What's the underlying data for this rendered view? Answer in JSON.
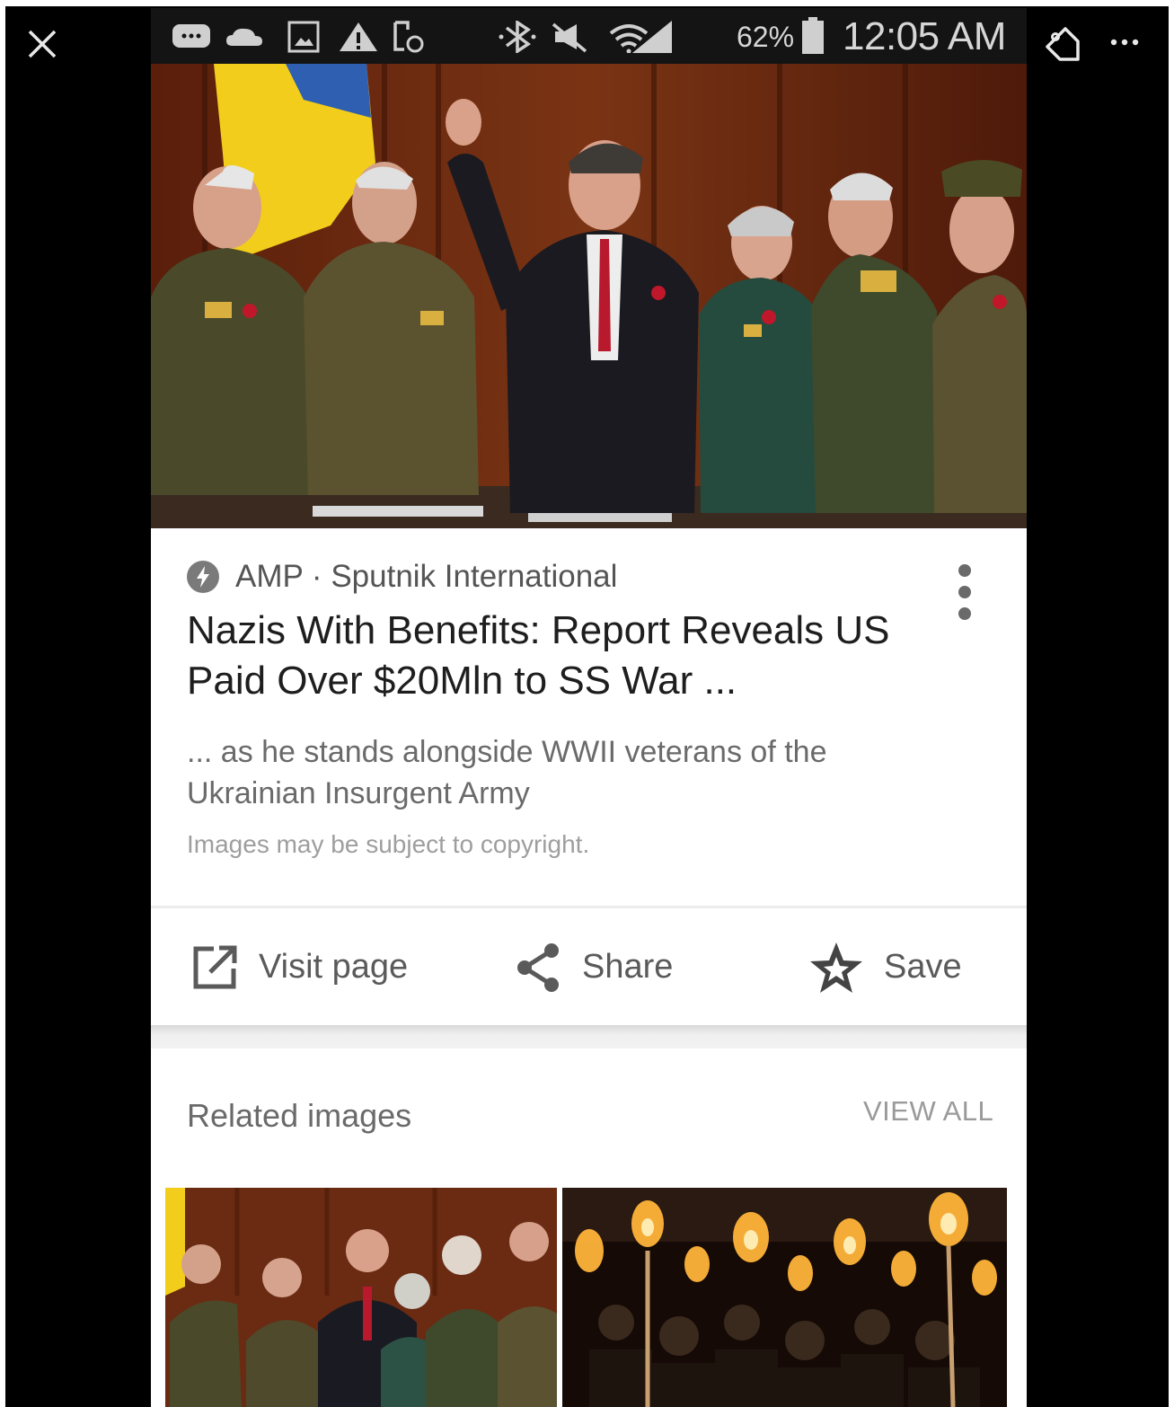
{
  "viewer": {
    "close_icon": "close-icon",
    "tag_icon": "tag-icon",
    "more_icon": "more-horizontal-icon"
  },
  "status_bar": {
    "icons": [
      "message-icon",
      "cloud-icon",
      "image-icon",
      "warning-icon",
      "screenshot-icon",
      "bluetooth-icon",
      "mute-icon",
      "wifi-icon",
      "signal-icon"
    ],
    "battery": "62%",
    "time": "12:05 AM"
  },
  "card": {
    "source": "AMP · Sputnik International",
    "title": "Nazis With Benefits: Report Reveals US Paid Over $20Mln to SS War ...",
    "snippet": "... as he stands alongside WWII veterans of the Ukrainian Insurgent Army",
    "copyright": "Images may be subject to copyright.",
    "actions": {
      "visit": "Visit page",
      "share": "Share",
      "save": "Save"
    }
  },
  "related": {
    "title": "Related images",
    "view_all": "VIEW ALL"
  },
  "colors": {
    "background": "#000000",
    "card": "#ffffff",
    "title_text": "#1e1e1e",
    "secondary_text": "#6a6a6a",
    "icon_gray": "#555555"
  }
}
